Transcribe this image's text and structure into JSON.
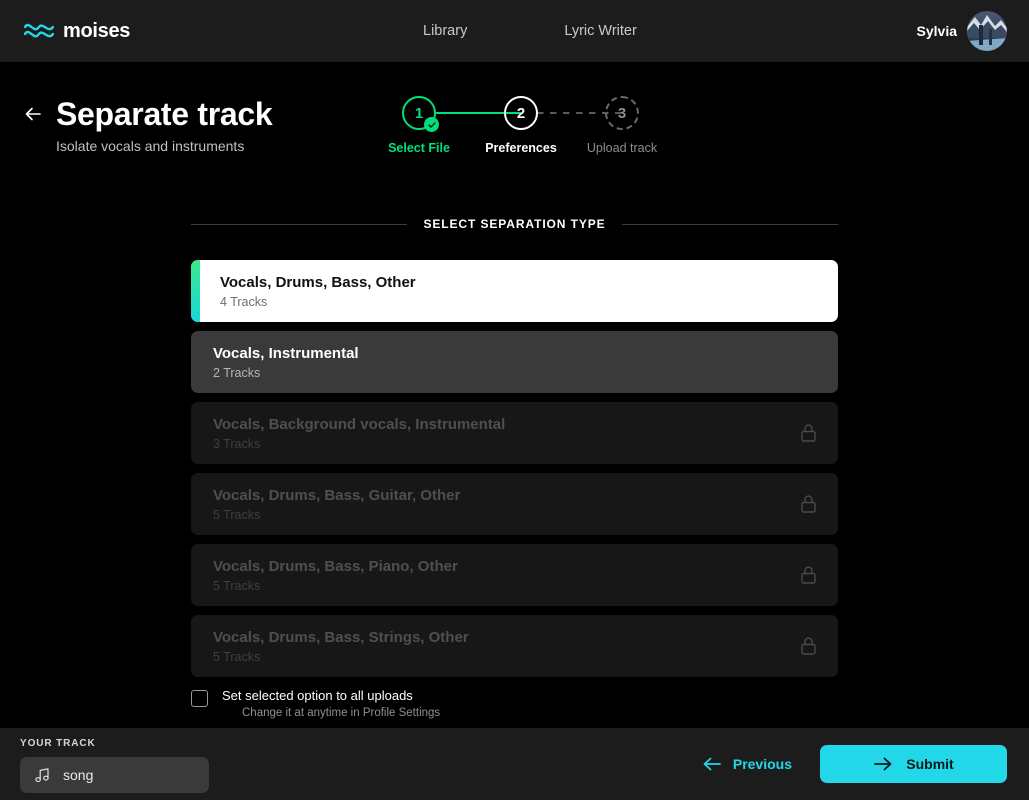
{
  "header": {
    "logo_text": "moises",
    "nav": [
      {
        "label": "Library"
      },
      {
        "label": "Lyric Writer"
      }
    ],
    "user_name": "Sylvia"
  },
  "page": {
    "title": "Separate track",
    "subtitle": "Isolate vocals and instruments"
  },
  "stepper": {
    "steps": [
      {
        "number": "1",
        "label": "Select File",
        "state": "done"
      },
      {
        "number": "2",
        "label": "Preferences",
        "state": "current"
      },
      {
        "number": "3",
        "label": "Upload track",
        "state": "todo"
      }
    ]
  },
  "section": {
    "label": "SELECT SEPARATION TYPE"
  },
  "options": [
    {
      "title": "Vocals, Drums, Bass, Other",
      "subtitle": "4 Tracks",
      "state": "selected",
      "locked": false
    },
    {
      "title": "Vocals, Instrumental",
      "subtitle": "2 Tracks",
      "state": "hover",
      "locked": false
    },
    {
      "title": "Vocals, Background vocals, Instrumental",
      "subtitle": "3 Tracks",
      "state": "locked",
      "locked": true
    },
    {
      "title": "Vocals, Drums, Bass, Guitar, Other",
      "subtitle": "5 Tracks",
      "state": "locked",
      "locked": true
    },
    {
      "title": "Vocals, Drums, Bass, Piano, Other",
      "subtitle": "5 Tracks",
      "state": "locked",
      "locked": true
    },
    {
      "title": "Vocals, Drums, Bass, Strings, Other",
      "subtitle": "5 Tracks",
      "state": "locked",
      "locked": true
    }
  ],
  "checkbox": {
    "checked": false,
    "title": "Set selected option to all uploads",
    "subtitle": "Change it at anytime in Profile Settings"
  },
  "bottom": {
    "track_label": "YOUR TRACK",
    "track_name": "song",
    "previous_label": "Previous",
    "submit_label": "Submit"
  },
  "colors": {
    "accent_cyan": "#22d7e8",
    "accent_green": "#00e07a",
    "header_bg": "#1c1c1c",
    "page_bg": "#000000"
  }
}
